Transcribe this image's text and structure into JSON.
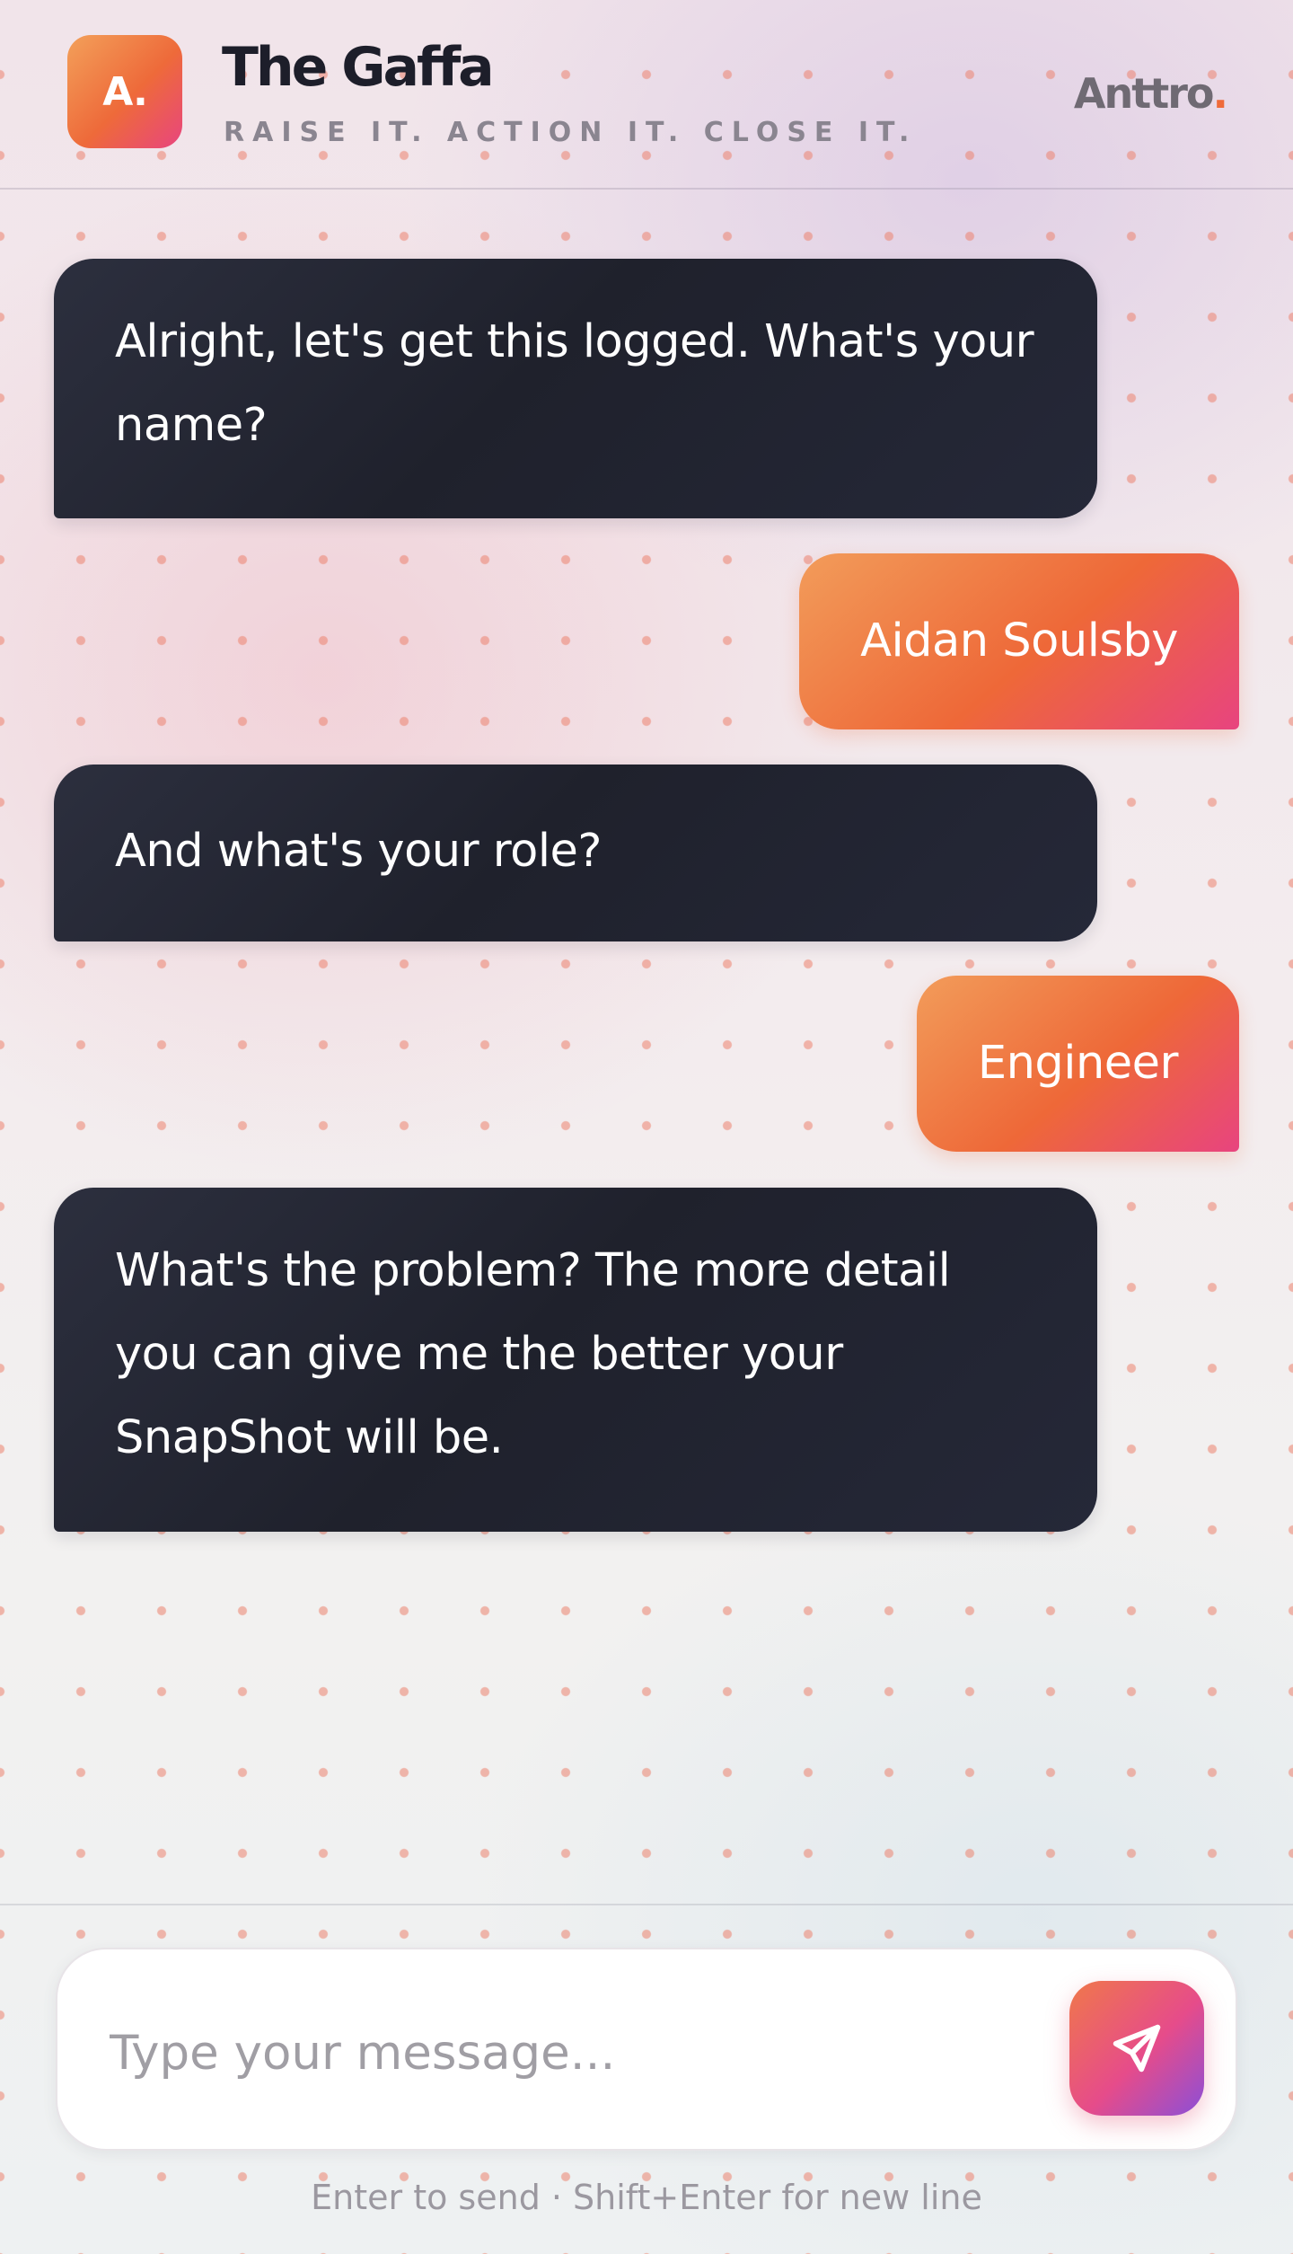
{
  "header": {
    "logo_text": "A.",
    "title": "The Gaffa",
    "tagline": "RAISE IT. ACTION IT. CLOSE IT.",
    "brand_name": "Anttro",
    "brand_dot": "."
  },
  "messages": [
    {
      "role": "bot",
      "text": "Alright, let's get this logged. What's your name?"
    },
    {
      "role": "user",
      "text": "Aidan Soulsby"
    },
    {
      "role": "bot",
      "text": "And what's your role?"
    },
    {
      "role": "user",
      "text": "Engineer"
    },
    {
      "role": "bot",
      "text": "What's the problem? The more detail you can give me the better your SnapShot will be."
    }
  ],
  "composer": {
    "placeholder": "Type your message...",
    "value": "",
    "send_icon": "send-icon",
    "hint": "Enter to send · Shift+Enter for new line"
  },
  "colors": {
    "accent_orange": "#ee6838",
    "accent_pink": "#e8447f",
    "accent_purple": "#8b4fd8",
    "bot_bubble": "#1f212c",
    "title_text": "#1d1e2a"
  }
}
